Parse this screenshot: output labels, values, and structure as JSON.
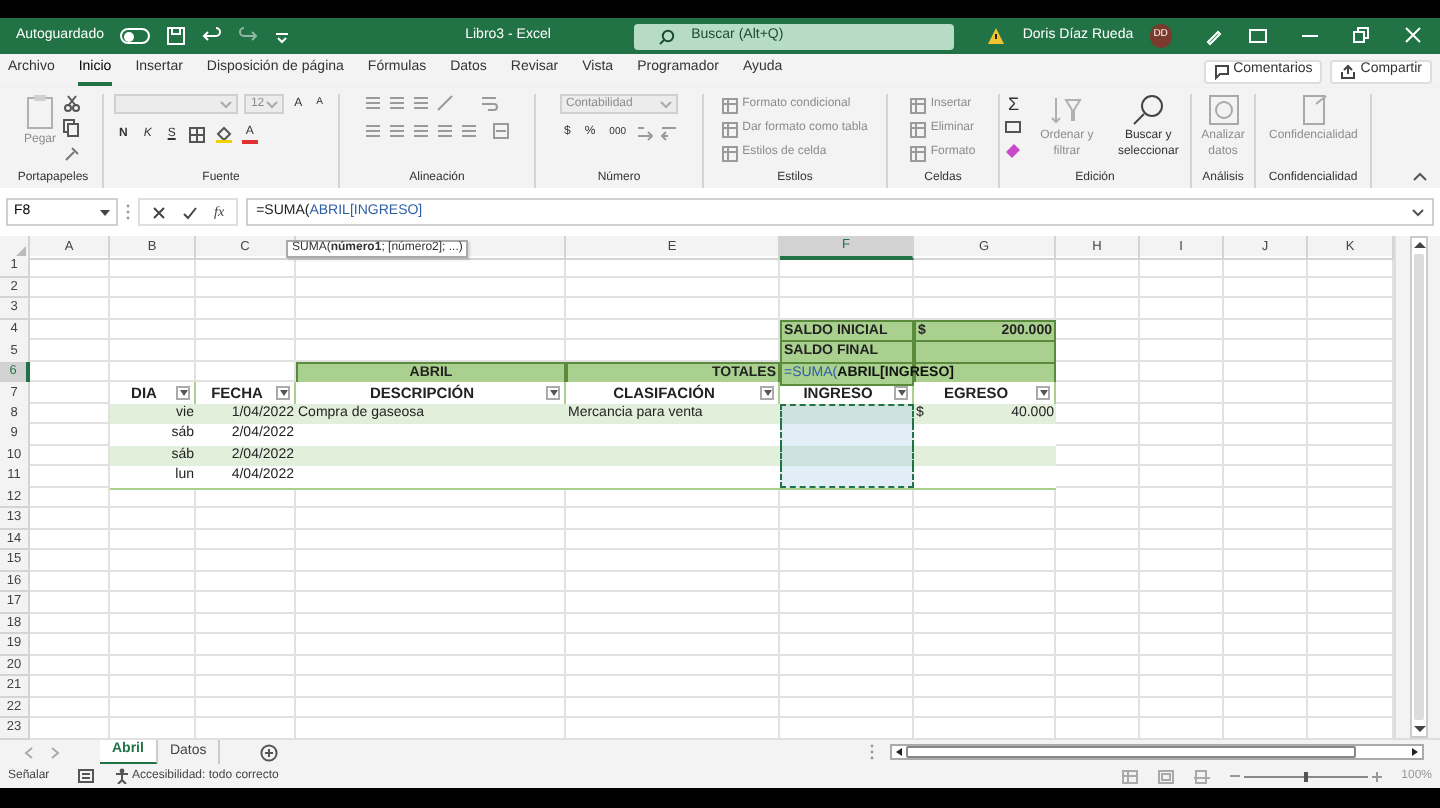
{
  "title_bar": {
    "autosave_label": "Autoguardado",
    "autosave_on": false,
    "title": "Libro3 - Excel",
    "search_placeholder": "Buscar (Alt+Q)",
    "user": "Doris Díaz Rueda",
    "avatar": "DD"
  },
  "menu": {
    "tabs": [
      {
        "label": "Archivo",
        "selected": false
      },
      {
        "label": "Inicio",
        "selected": true
      },
      {
        "label": "Insertar",
        "selected": false
      },
      {
        "label": "Disposición de página",
        "selected": false
      },
      {
        "label": "Fórmulas",
        "selected": false
      },
      {
        "label": "Datos",
        "selected": false
      },
      {
        "label": "Revisar",
        "selected": false
      },
      {
        "label": "Vista",
        "selected": false
      },
      {
        "label": "Programador",
        "selected": false
      },
      {
        "label": "Ayuda",
        "selected": false
      }
    ],
    "buttons": [
      "Comentarios",
      "Compartir"
    ]
  },
  "ribbon": [
    {
      "label": "Portapapeles",
      "items": [
        {
          "kind": "large",
          "label": "Pegar",
          "disabled": true
        }
      ]
    },
    {
      "label": "Fuente",
      "items": [
        {
          "kind": "dropdown",
          "disabled": true
        },
        {
          "kind": "dropdown",
          "value": "12",
          "disabled": true
        },
        {
          "kind": "glyph",
          "label": "A",
          "disabled": false
        },
        {
          "kind": "glyph",
          "label": "A",
          "disabled": false
        },
        {
          "kind": "glyph",
          "label": "N",
          "disabled": false
        },
        {
          "kind": "glyph",
          "label": "K",
          "disabled": false
        },
        {
          "kind": "glyph",
          "label": "S",
          "disabled": false
        },
        {
          "kind": "glyph",
          "label": "A",
          "disabled": false
        }
      ]
    },
    {
      "label": "Alineación"
    },
    {
      "label": "Número",
      "items": [
        {
          "kind": "dropdown",
          "value": "Contabilidad",
          "disabled": true
        },
        {
          "kind": "glyph",
          "label": "$",
          "disabled": false
        },
        {
          "kind": "glyph",
          "label": "%",
          "disabled": false
        },
        {
          "kind": "glyph",
          "label": "000",
          "disabled": false
        }
      ]
    },
    {
      "label": "Estilos",
      "items": [
        {
          "kind": "small",
          "label": "Formato condicional",
          "disabled": true
        },
        {
          "kind": "small",
          "label": "Dar formato como tabla",
          "disabled": true
        },
        {
          "kind": "small",
          "label": "Estilos de celda",
          "disabled": true
        }
      ]
    },
    {
      "label": "Celdas",
      "items": [
        {
          "kind": "small",
          "label": "Insertar",
          "disabled": true
        },
        {
          "kind": "small",
          "label": "Eliminar",
          "disabled": true
        },
        {
          "kind": "small",
          "label": "Formato",
          "disabled": true
        }
      ]
    },
    {
      "label": "Edición",
      "items": [
        {
          "kind": "glyph",
          "label": "Σ",
          "disabled": false
        },
        {
          "kind": "large",
          "label": "Ordenar y filtrar",
          "disabled": true
        },
        {
          "kind": "large",
          "label": "Buscar y seleccionar",
          "disabled": false
        }
      ]
    },
    {
      "label": "Análisis",
      "items": [
        {
          "kind": "large",
          "label": "Analizar datos",
          "disabled": true
        }
      ]
    },
    {
      "label": "Confidencialidad",
      "items": [
        {
          "kind": "large",
          "label": "Confidencialidad",
          "disabled": true
        }
      ]
    }
  ],
  "formula_bar": {
    "name_box": "F8",
    "fx": "fx",
    "formula": [
      {
        "kind": "function",
        "text": "=SUMA("
      },
      {
        "kind": "reference",
        "text": "ABRIL[INGRESO]"
      }
    ]
  },
  "tooltip": "SUMA(**número1**; [número2]; ...)",
  "sheet": {
    "columns": [
      {
        "label": "A",
        "selected": false
      },
      {
        "label": "B",
        "selected": false
      },
      {
        "label": "C",
        "selected": false
      },
      {
        "selected": false
      },
      {
        "label": "E",
        "selected": false
      },
      {
        "label": "F",
        "selected": true
      },
      {
        "label": "G",
        "selected": false
      },
      {
        "label": "H",
        "selected": false
      },
      {
        "label": "I",
        "selected": false
      },
      {
        "label": "J",
        "selected": false
      },
      {
        "label": "K",
        "selected": false
      }
    ],
    "rows": [
      {
        "number": "1",
        "selected": false
      },
      {
        "number": "2",
        "selected": false
      },
      {
        "number": "3",
        "selected": false
      },
      {
        "number": "4",
        "selected": false,
        "cells": [
          {
            "kind": "blank"
          },
          {
            "kind": "blank"
          },
          {
            "kind": "blank"
          },
          {
            "kind": "blank"
          },
          {
            "kind": "blank"
          },
          {
            "kind": "total",
            "text": "SALDO INICIAL"
          },
          {
            "kind": "total",
            "symbol": "$",
            "text": "200.000"
          }
        ]
      },
      {
        "number": "5",
        "selected": false,
        "cells": [
          {
            "kind": "blank"
          },
          {
            "kind": "blank"
          },
          {
            "kind": "blank"
          },
          {
            "kind": "blank"
          },
          {
            "kind": "blank"
          },
          {
            "kind": "total",
            "text": "SALDO FINAL"
          },
          {
            "kind": "total"
          }
        ]
      },
      {
        "number": "6",
        "selected": true,
        "cells": [
          {
            "kind": "blank"
          },
          {
            "kind": "blank"
          },
          {
            "kind": "blank"
          },
          {
            "kind": "total-title",
            "text": "ABRIL"
          },
          {
            "kind": "total-caption",
            "text": "TOTALES"
          },
          {
            "kind": "total",
            "formula": [
              {
                "kind": "function",
                "text": "=SUMA("
              },
              {
                "kind": "reference",
                "text": "ABRIL[INGRESO]"
              }
            ]
          },
          {
            "kind": "total"
          }
        ]
      },
      {
        "number": "7",
        "selected": false,
        "cells": [
          {
            "kind": "blank"
          },
          {
            "kind": "header",
            "text": "DIA"
          },
          {
            "kind": "header",
            "text": "FECHA"
          },
          {
            "kind": "header",
            "text": "DESCRIPCIÓN"
          },
          {
            "kind": "header",
            "text": "CLASIFACIÓN"
          },
          {
            "kind": "header",
            "text": "INGRESO"
          },
          {
            "kind": "header",
            "text": "EGRESO"
          }
        ]
      },
      {
        "number": "8",
        "selected": false,
        "band": true,
        "cells": [
          {
            "kind": "blank"
          },
          {
            "kind": "number",
            "text": "vie",
            "selected": false
          },
          {
            "kind": "number",
            "text": "1/04/2022",
            "selected": false
          },
          {
            "kind": "text",
            "text": "Compra de gaseosa",
            "selected": false
          },
          {
            "kind": "text",
            "text": "Mercancia para venta",
            "selected": false
          },
          {
            "kind": "text",
            "selected": true
          },
          {
            "kind": "amount",
            "symbol": "$",
            "text": "40.000",
            "selected": false
          }
        ]
      },
      {
        "number": "9",
        "selected": false,
        "band": false,
        "cells": [
          {
            "kind": "blank"
          },
          {
            "kind": "number",
            "text": "sáb",
            "selected": false
          },
          {
            "kind": "number",
            "text": "2/04/2022",
            "selected": false
          },
          {
            "kind": "text",
            "selected": false
          },
          {
            "kind": "text",
            "selected": false
          },
          {
            "kind": "text",
            "selected": true
          },
          {
            "kind": "text",
            "selected": false
          }
        ]
      },
      {
        "number": "10",
        "selected": false,
        "band": true,
        "cells": [
          {
            "kind": "blank"
          },
          {
            "kind": "number",
            "text": "sáb",
            "selected": false
          },
          {
            "kind": "number",
            "text": "2/04/2022",
            "selected": false
          },
          {
            "kind": "text",
            "selected": false
          },
          {
            "kind": "text",
            "selected": false
          },
          {
            "kind": "text",
            "selected": true
          },
          {
            "kind": "text",
            "selected": false
          }
        ]
      },
      {
        "number": "11",
        "selected": false,
        "band": false,
        "cells": [
          {
            "kind": "blank"
          },
          {
            "kind": "number",
            "text": "lun",
            "selected": false
          },
          {
            "kind": "number",
            "text": "4/04/2022",
            "selected": false
          },
          {
            "kind": "text",
            "selected": false
          },
          {
            "kind": "text",
            "selected": false
          },
          {
            "kind": "text",
            "selected": true
          },
          {
            "kind": "text",
            "selected": false
          }
        ]
      },
      {
        "number": "12",
        "selected": false
      },
      {
        "number": "13",
        "selected": false
      },
      {
        "number": "14",
        "selected": false
      },
      {
        "number": "15",
        "selected": false
      },
      {
        "number": "16",
        "selected": false
      },
      {
        "number": "17",
        "selected": false
      },
      {
        "number": "18",
        "selected": false
      },
      {
        "number": "19",
        "selected": false
      },
      {
        "number": "20",
        "selected": false
      },
      {
        "number": "21",
        "selected": false
      },
      {
        "number": "22",
        "selected": false
      },
      {
        "number": "23",
        "selected": false
      }
    ]
  },
  "sheet_tabs": [
    {
      "label": "Abril",
      "selected": true
    },
    {
      "label": "Datos",
      "selected": false
    }
  ],
  "status_bar": {
    "mode": "Señalar",
    "accessibility": "Accesibilidad: todo correcto",
    "zoom": {
      "level": 0.5,
      "reading": "100%"
    }
  }
}
